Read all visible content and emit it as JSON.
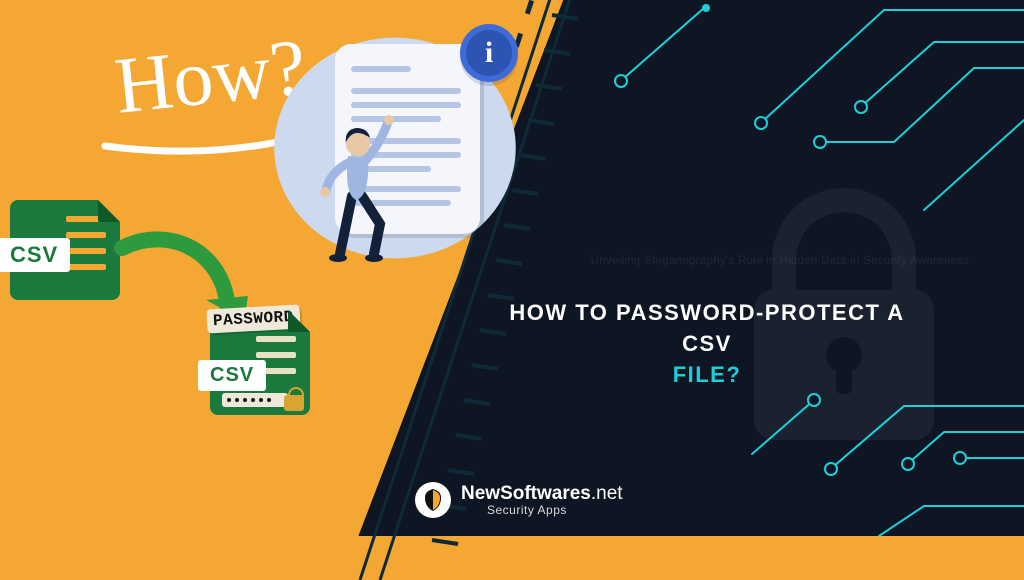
{
  "left": {
    "how": "How?",
    "csv_label": "CSV",
    "password_label": "PASSWORD"
  },
  "info_glyph": "i",
  "title": {
    "line1": "HOW TO PASSWORD-PROTECT A CSV",
    "highlight": "FILE?"
  },
  "ghost_text": "Unveiling Steganography's Role in Hidden Data in Security Awareness",
  "brand": {
    "name_bold": "NewSoftwares",
    "name_ext": ".net",
    "tagline": "Security Apps"
  },
  "icons": {
    "info": "info-icon",
    "lock": "lock-icon",
    "csv": "csv-file-icon",
    "arrow": "arrow-icon"
  },
  "colors": {
    "accent": "#1cd0d9",
    "dark": "#0e1624",
    "orange": "#f4a733",
    "green": "#1a7a3e"
  }
}
